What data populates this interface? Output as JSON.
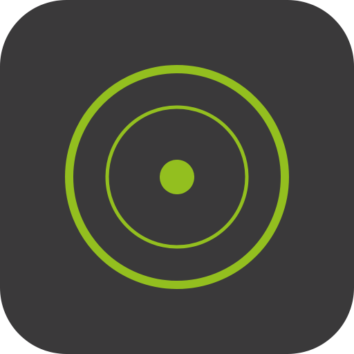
{
  "icon": {
    "name": "concentric-rings-target-icon",
    "colors": {
      "background": "#3a393a",
      "accent": "#93bf1f",
      "page": "#ffffff"
    }
  }
}
